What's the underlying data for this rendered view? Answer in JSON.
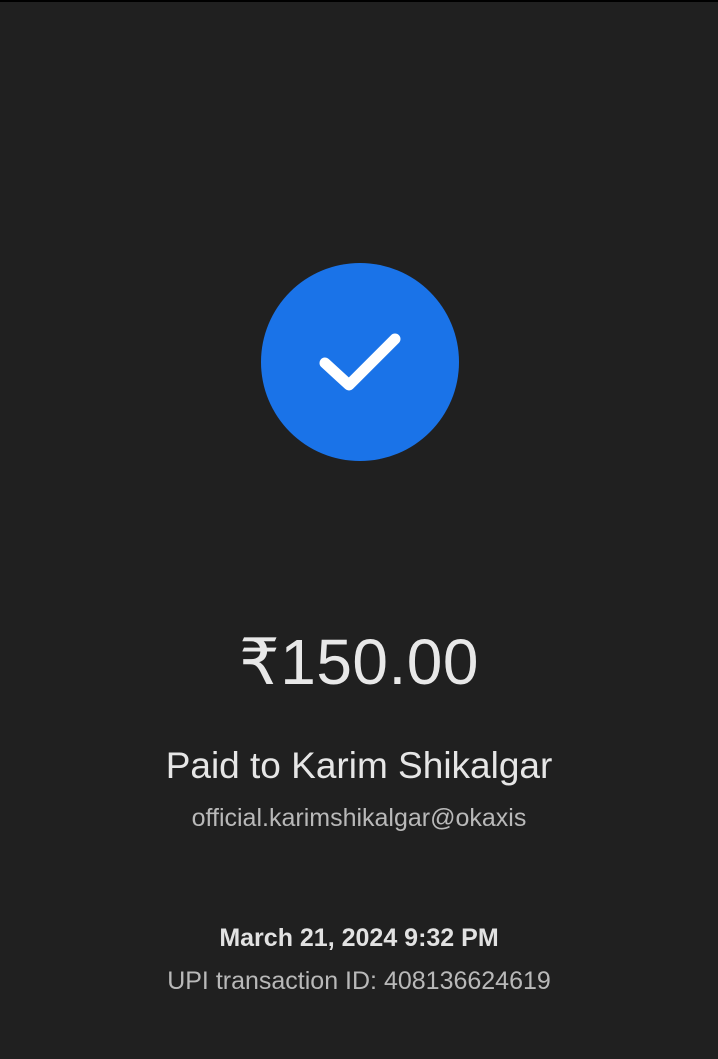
{
  "colors": {
    "background": "#202020",
    "accent": "#1a73e8",
    "checkmark": "#ffffff"
  },
  "status": {
    "icon": "checkmark-icon"
  },
  "payment": {
    "amount": "₹150.00",
    "paid_to": "Paid to Karim Shikalgar",
    "upi_id": "official.karimshikalgar@okaxis",
    "datetime": "March 21, 2024 9:32 PM",
    "transaction_id": "UPI transaction ID: 408136624619"
  }
}
